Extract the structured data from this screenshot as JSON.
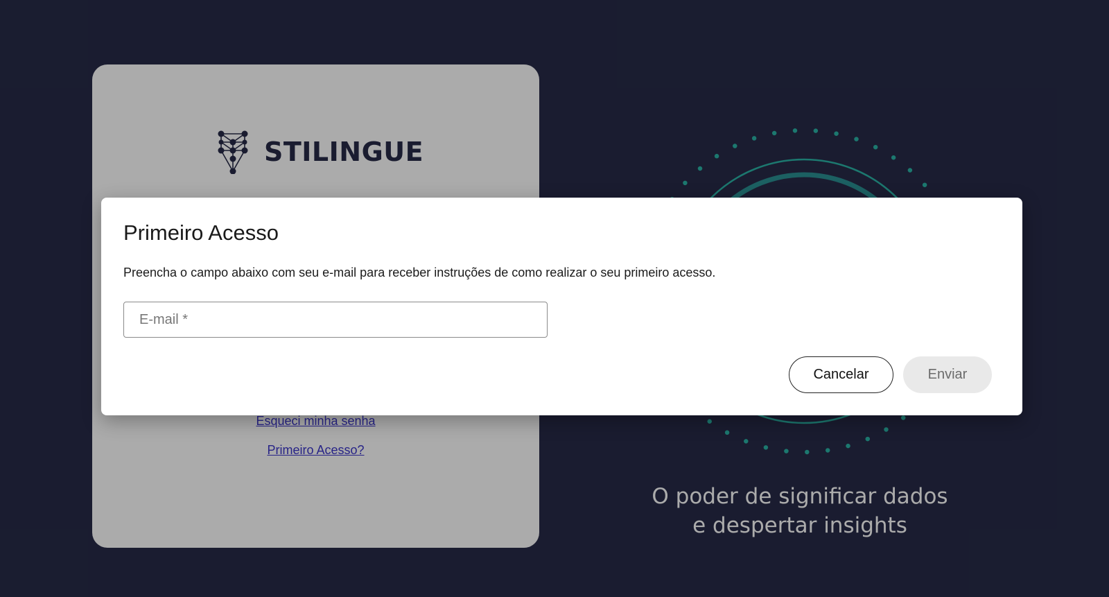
{
  "login": {
    "logo_text": "STILINGUE",
    "forgot_password_link": "Esqueci minha senha",
    "first_access_link": "Primeiro Acesso?"
  },
  "hero": {
    "tagline_line1": "O poder de significar dados",
    "tagline_line2": "e despertar insights"
  },
  "dialog": {
    "title": "Primeiro Acesso",
    "description": "Preencha o campo abaixo com seu e-mail para receber instruções de como realizar o seu primeiro acesso.",
    "email_placeholder": "E-mail *",
    "email_value": "",
    "cancel_label": "Cancelar",
    "send_label": "Enviar"
  },
  "colors": {
    "background": "#272b48",
    "brand_navy": "#272b48",
    "ring_teal": "#2bb3a6",
    "link": "#3b35c9"
  },
  "icons": {
    "logo": "network-graph-logo-icon"
  }
}
